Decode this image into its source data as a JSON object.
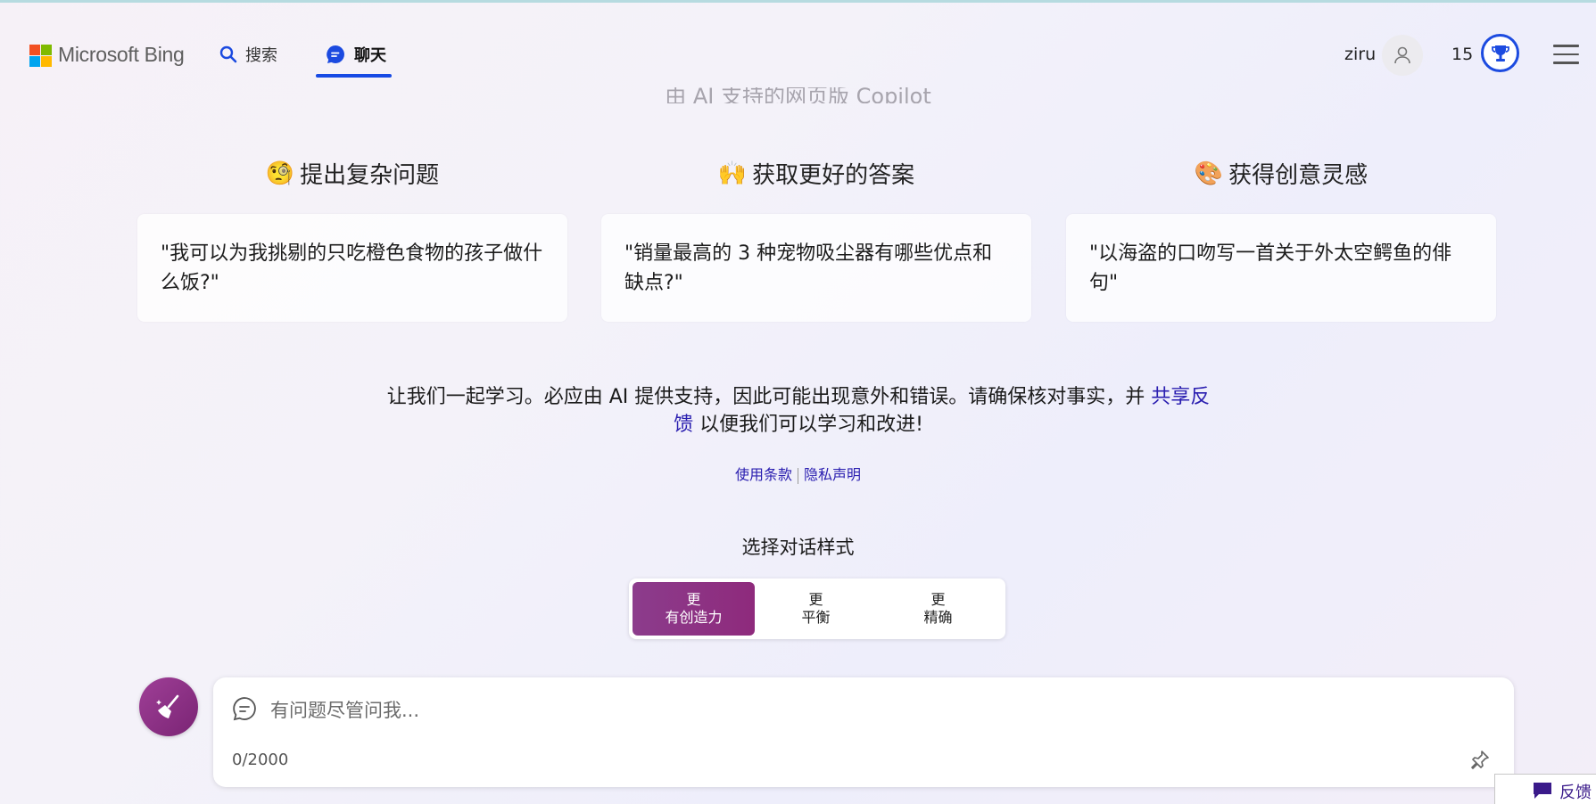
{
  "header": {
    "brand": "Microsoft Bing",
    "tabs": [
      {
        "label": "搜索",
        "icon": "search-icon",
        "active": false
      },
      {
        "label": "聊天",
        "icon": "chat-icon",
        "active": true
      }
    ],
    "user_name": "ziru",
    "reward_points": "15"
  },
  "subtitle": "由 AI 支持的网页版 Copilot",
  "features": [
    {
      "emoji": "🧐",
      "title": "提出复杂问题",
      "example": "\"我可以为我挑剔的只吃橙色食物的孩子做什么饭?\""
    },
    {
      "emoji": "🙌",
      "title": "获取更好的答案",
      "example": "\"销量最高的 3 种宠物吸尘器有哪些优点和缺点?\""
    },
    {
      "emoji": "🎨",
      "title": "获得创意灵感",
      "example": "\"以海盗的口吻写一首关于外太空鳄鱼的俳句\""
    }
  ],
  "disclaimer": {
    "text_before": "让我们一起学习。必应由 AI 提供支持，因此可能出现意外和错误。请确保核对事实，并 ",
    "link": "共享反馈",
    "text_after": " 以便我们可以学习和改进!"
  },
  "links": {
    "terms": "使用条款",
    "privacy": "隐私声明"
  },
  "conversation_style": {
    "title": "选择对话样式",
    "options": [
      {
        "line1": "更",
        "line2": "有创造力",
        "active": true
      },
      {
        "line1": "更",
        "line2": "平衡",
        "active": false
      },
      {
        "line1": "更",
        "line2": "精确",
        "active": false
      }
    ]
  },
  "input": {
    "placeholder": "有问题尽管问我...",
    "value": "",
    "char_count": "0/2000"
  },
  "feedback_label": "反馈",
  "colors": {
    "accent_blue": "#174ae4",
    "creative_purple": "#8c3c8c",
    "link": "#2a1eb0"
  }
}
